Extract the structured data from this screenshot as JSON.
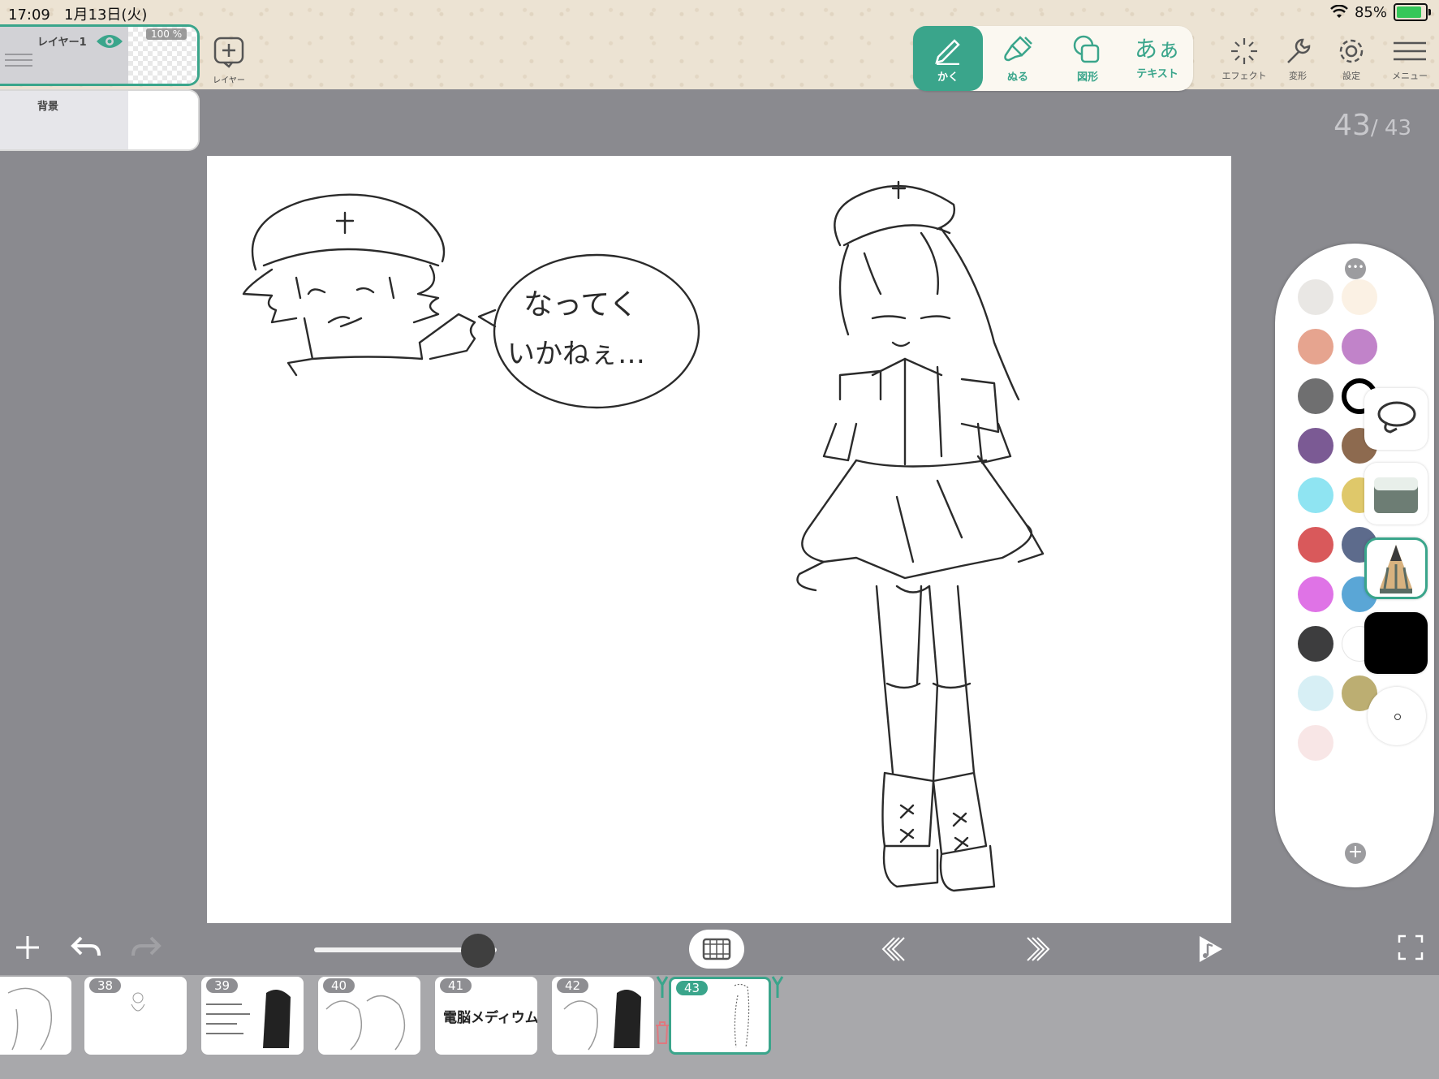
{
  "status": {
    "time": "17:09",
    "date": "1月13日(火)",
    "battery_pct": "85%"
  },
  "layers": [
    {
      "name": "レイヤー1",
      "opacity": "100 %",
      "selected": true
    },
    {
      "name": "背景",
      "selected": false
    }
  ],
  "layer_button_label": "レイヤー",
  "tools": [
    {
      "id": "draw",
      "label": "かく",
      "active": true
    },
    {
      "id": "fill",
      "label": "ぬる",
      "active": false
    },
    {
      "id": "shape",
      "label": "図形",
      "active": false
    },
    {
      "id": "text",
      "label": "テキスト",
      "glyph": "あぁ",
      "active": false
    }
  ],
  "right_tools": [
    {
      "label": "エフェクト",
      "icon": "sparkle-icon"
    },
    {
      "label": "変形",
      "icon": "wrench-icon"
    },
    {
      "label": "設定",
      "icon": "gear-icon"
    },
    {
      "label": "メニュー",
      "icon": "hamburger-icon"
    }
  ],
  "page_counter": {
    "current": "43",
    "total": "/ 43"
  },
  "palette": {
    "colors": [
      "#e9e7e4",
      "#fbf1e4",
      "#e6a48f",
      "#c183c9",
      "#6f6f70",
      "#ffffff",
      "#7b5a94",
      "#8d6a4f",
      "#8fe4f2",
      "#dfc86a",
      "#d9595b",
      "#5d6b8c",
      "#df73e6",
      "#5aa6d6",
      "#3d3d3e",
      "#ffffff",
      "#d7eff5",
      "#bcae72",
      "#f8e6e6"
    ],
    "selected_color": "#000000",
    "brush_size_label": ""
  },
  "frames": [
    {
      "num": ""
    },
    {
      "num": "38"
    },
    {
      "num": "39"
    },
    {
      "num": "40"
    },
    {
      "num": "41",
      "text": "電脳メディウム"
    },
    {
      "num": "42"
    },
    {
      "num": "43",
      "selected": true
    }
  ],
  "speech_bubble_text": "なってく いかねぇ…"
}
